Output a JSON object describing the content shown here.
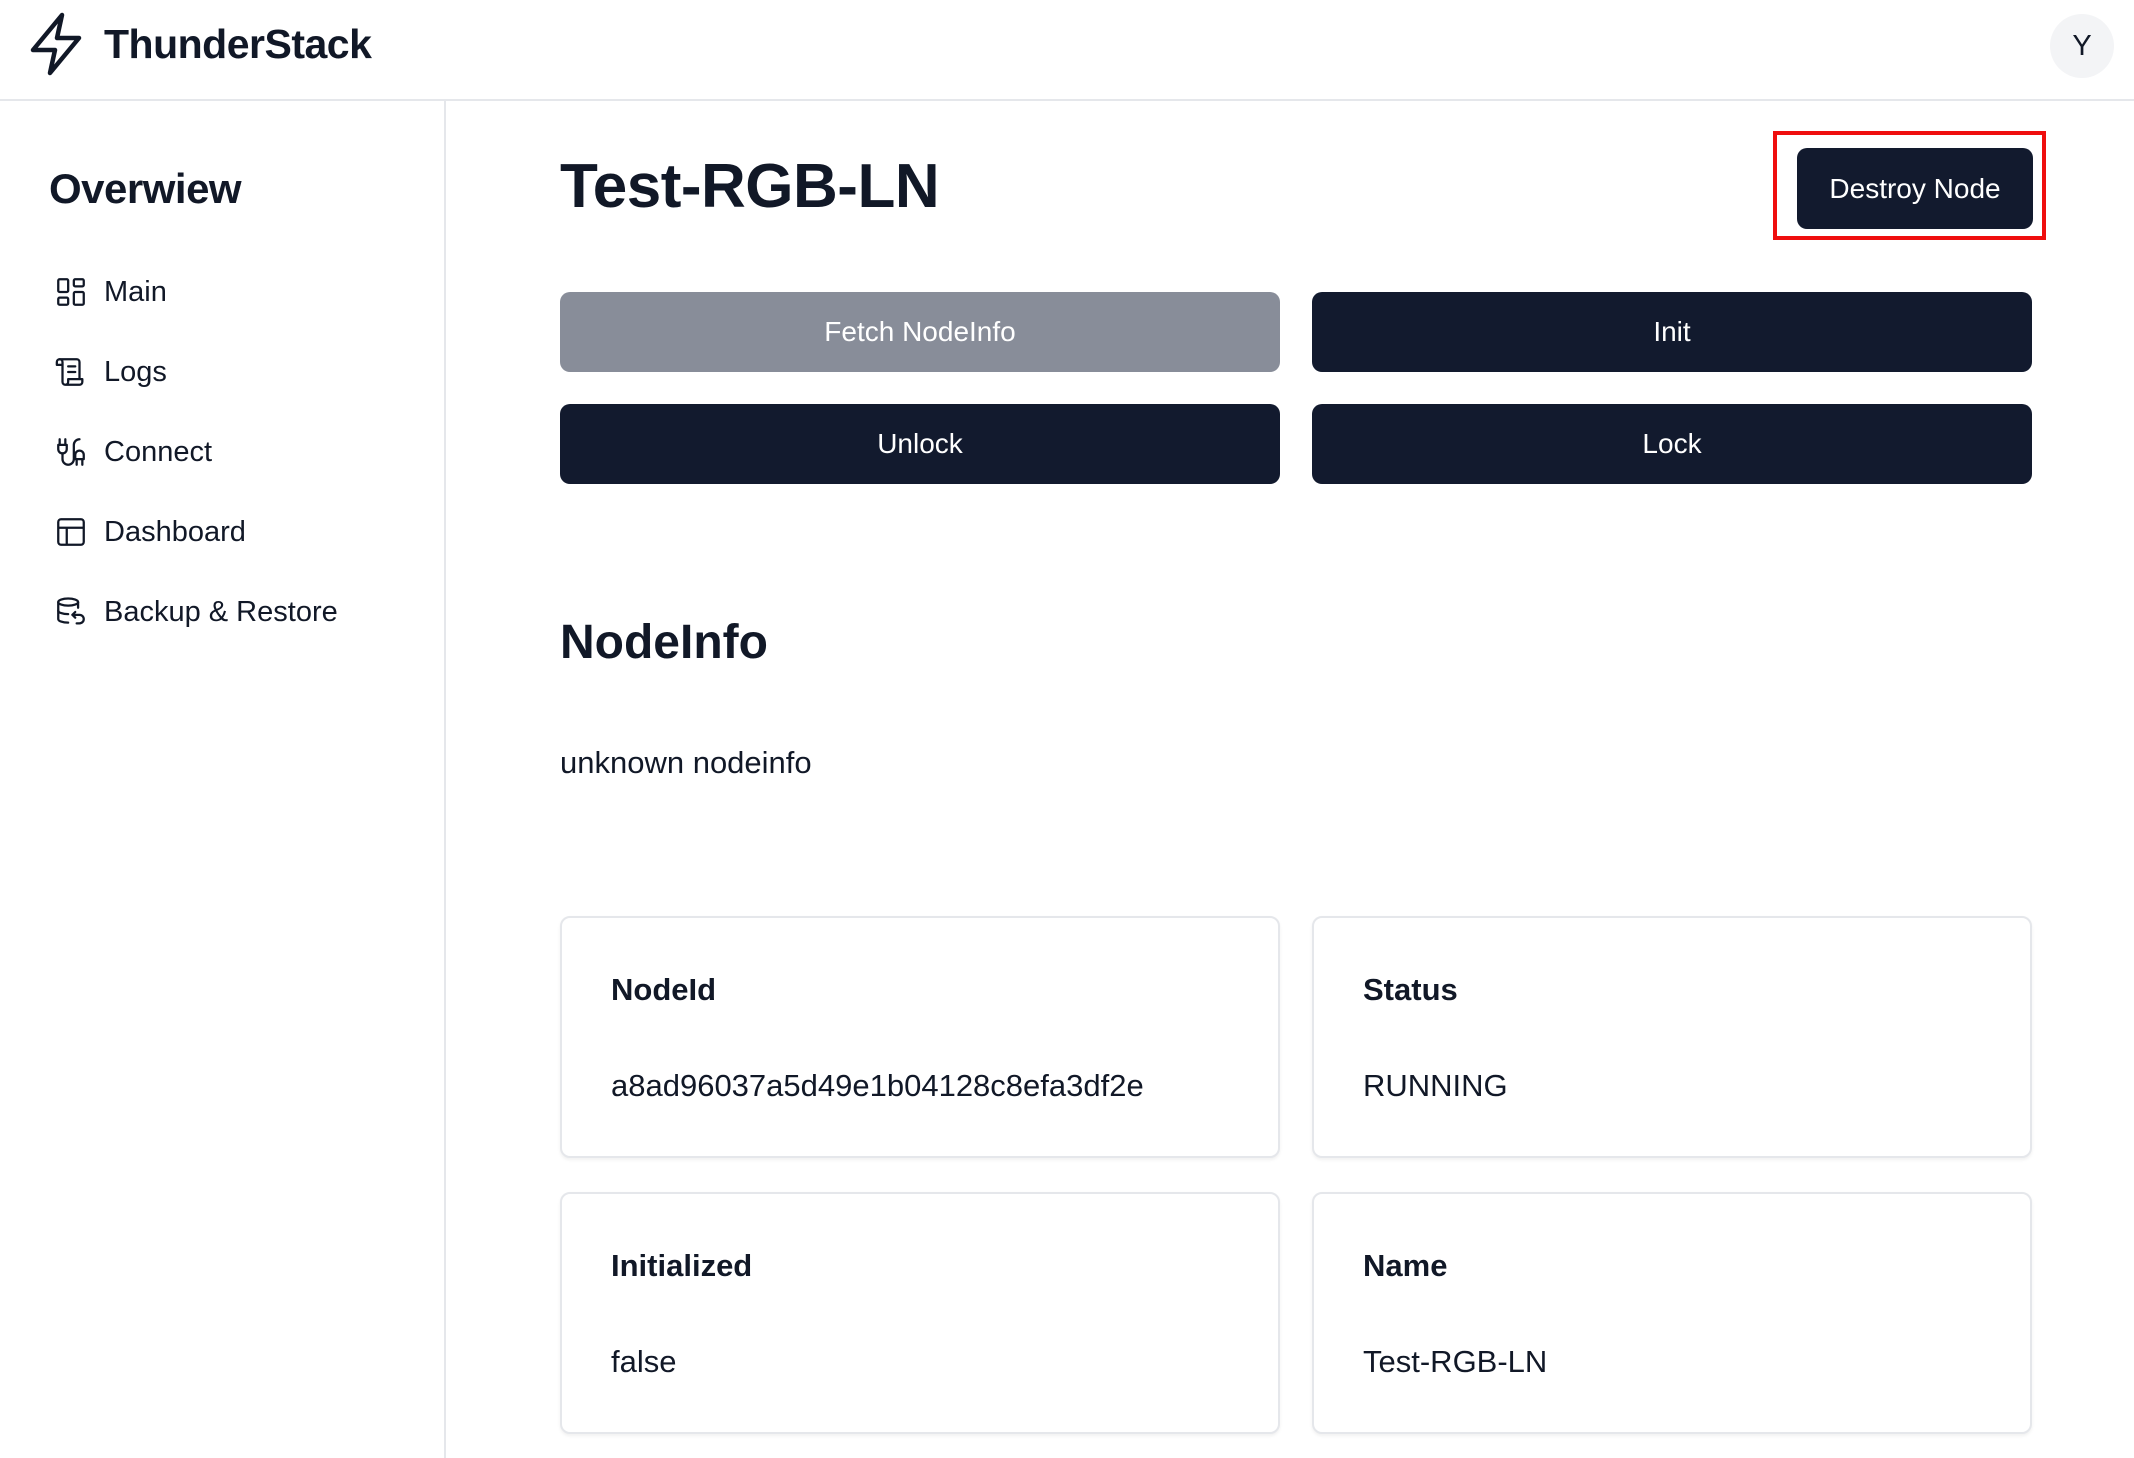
{
  "header": {
    "brand": "ThunderStack",
    "avatar_initial": "Y"
  },
  "sidebar": {
    "title": "Overwiew",
    "items": [
      {
        "label": "Main",
        "icon": "grid-icon"
      },
      {
        "label": "Logs",
        "icon": "scroll-icon"
      },
      {
        "label": "Connect",
        "icon": "plug-icon"
      },
      {
        "label": "Dashboard",
        "icon": "layout-icon"
      },
      {
        "label": "Backup & Restore",
        "icon": "database-restore-icon"
      }
    ]
  },
  "main": {
    "title": "Test-RGB-LN",
    "destroy_label": "Destroy Node",
    "actions": {
      "fetch": "Fetch NodeInfo",
      "init": "Init",
      "unlock": "Unlock",
      "lock": "Lock"
    },
    "nodeinfo": {
      "title": "NodeInfo",
      "text": "unknown nodeinfo"
    },
    "cards": [
      {
        "label": "NodeId",
        "value": "a8ad96037a5d49e1b04128c8efa3df2e"
      },
      {
        "label": "Status",
        "value": "RUNNING"
      },
      {
        "label": "Initialized",
        "value": "false"
      },
      {
        "label": "Name",
        "value": "Test-RGB-LN"
      }
    ]
  },
  "colors": {
    "primary_button": "#121a2e",
    "disabled_button": "#888d99",
    "highlight": "#ef0e0e",
    "border": "#e5e7eb"
  }
}
